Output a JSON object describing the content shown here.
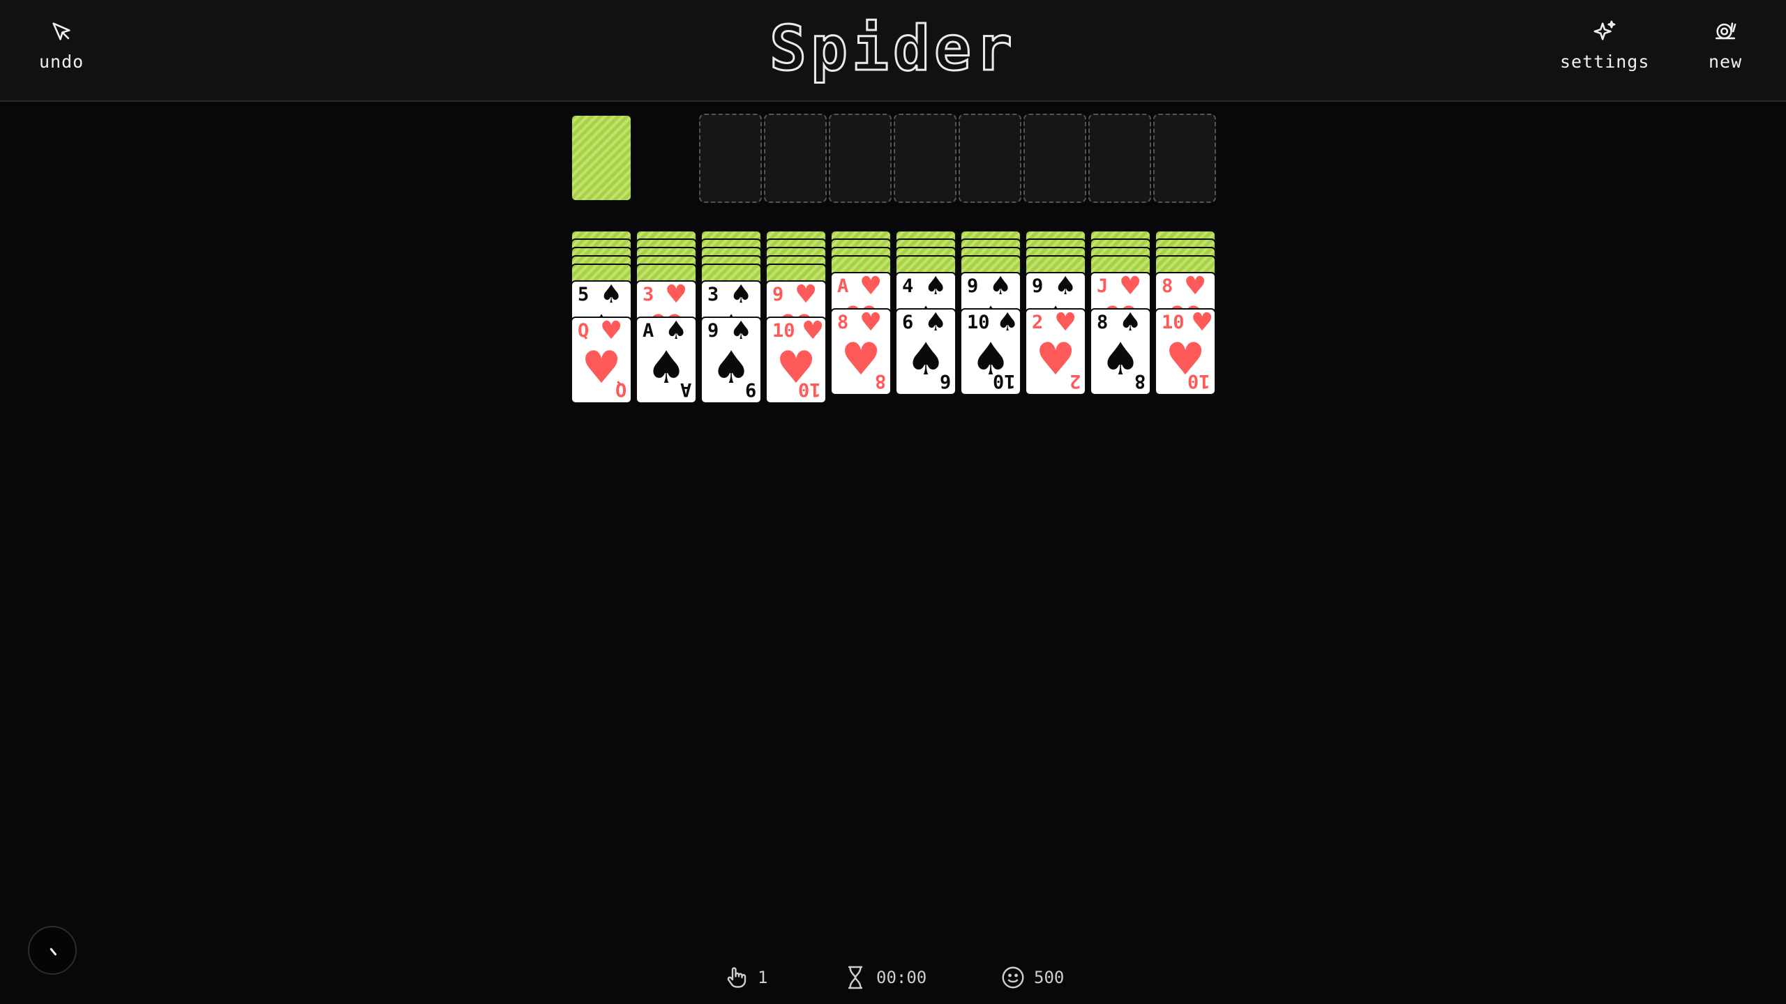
{
  "header": {
    "title": "Spider",
    "undo_label": "undo",
    "settings_label": "settings",
    "new_label": "new"
  },
  "colors": {
    "card_back": "#a8d14a",
    "red_suit": "#ff5a5a",
    "black_suit": "#0a0a0a",
    "background": "#08080a"
  },
  "stock": {
    "face_down_cards": 1
  },
  "foundations": {
    "empty_slots": 8
  },
  "tableau": [
    {
      "hidden": 5,
      "cards": [
        {
          "rank": "5",
          "suit": "♠",
          "color": "black"
        },
        {
          "rank": "Q",
          "suit": "♥",
          "color": "red"
        }
      ]
    },
    {
      "hidden": 5,
      "cards": [
        {
          "rank": "3",
          "suit": "♥",
          "color": "red"
        },
        {
          "rank": "A",
          "suit": "♠",
          "color": "black"
        }
      ]
    },
    {
      "hidden": 5,
      "cards": [
        {
          "rank": "3",
          "suit": "♠",
          "color": "black"
        },
        {
          "rank": "9",
          "suit": "♠",
          "color": "black"
        }
      ]
    },
    {
      "hidden": 5,
      "cards": [
        {
          "rank": "9",
          "suit": "♥",
          "color": "red"
        },
        {
          "rank": "10",
          "suit": "♥",
          "color": "red"
        }
      ]
    },
    {
      "hidden": 4,
      "cards": [
        {
          "rank": "A",
          "suit": "♥",
          "color": "red"
        },
        {
          "rank": "8",
          "suit": "♥",
          "color": "red"
        }
      ]
    },
    {
      "hidden": 4,
      "cards": [
        {
          "rank": "4",
          "suit": "♠",
          "color": "black"
        },
        {
          "rank": "6",
          "suit": "♠",
          "color": "black"
        }
      ]
    },
    {
      "hidden": 4,
      "cards": [
        {
          "rank": "9",
          "suit": "♠",
          "color": "black"
        },
        {
          "rank": "10",
          "suit": "♠",
          "color": "black"
        }
      ]
    },
    {
      "hidden": 4,
      "cards": [
        {
          "rank": "9",
          "suit": "♠",
          "color": "black"
        },
        {
          "rank": "2",
          "suit": "♥",
          "color": "red"
        }
      ]
    },
    {
      "hidden": 4,
      "cards": [
        {
          "rank": "J",
          "suit": "♥",
          "color": "red"
        },
        {
          "rank": "8",
          "suit": "♠",
          "color": "black"
        }
      ]
    },
    {
      "hidden": 4,
      "cards": [
        {
          "rank": "8",
          "suit": "♥",
          "color": "red"
        },
        {
          "rank": "10",
          "suit": "♥",
          "color": "red"
        }
      ]
    }
  ],
  "status": {
    "moves": "1",
    "time": "00:00",
    "score": "500"
  }
}
